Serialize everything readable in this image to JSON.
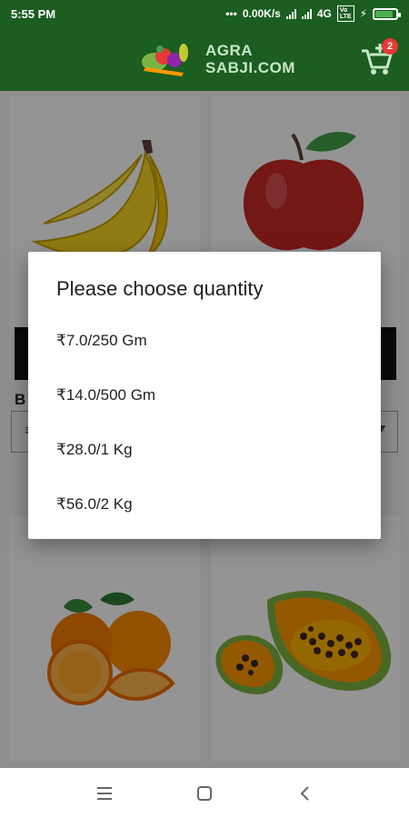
{
  "status_bar": {
    "time": "5:55 PM",
    "net_speed": "0.00K/s",
    "network": "4G",
    "volte": "VoLTE"
  },
  "app_bar": {
    "logo_line1": "AGRA",
    "logo_line2": "SABJI.COM",
    "cart_count": "2"
  },
  "background_products": [
    {
      "name_partial": "B",
      "price_partial": "₹"
    },
    {
      "name_partial": "",
      "price_partial": ""
    }
  ],
  "dialog": {
    "title": "Please choose quantity",
    "options": [
      {
        "label": "₹7.0/250 Gm"
      },
      {
        "label": "₹14.0/500 Gm"
      },
      {
        "label": "₹28.0/1 Kg"
      },
      {
        "label": "₹56.0/2 Kg"
      }
    ]
  },
  "colors": {
    "primary": "#1b5e20",
    "badge": "#e53935",
    "add_bar": "#111111"
  },
  "icons": {
    "cart": "cart-plus-icon",
    "nav_menu": "menu-icon",
    "nav_home": "home-square-icon",
    "nav_back": "back-chevron-icon"
  }
}
